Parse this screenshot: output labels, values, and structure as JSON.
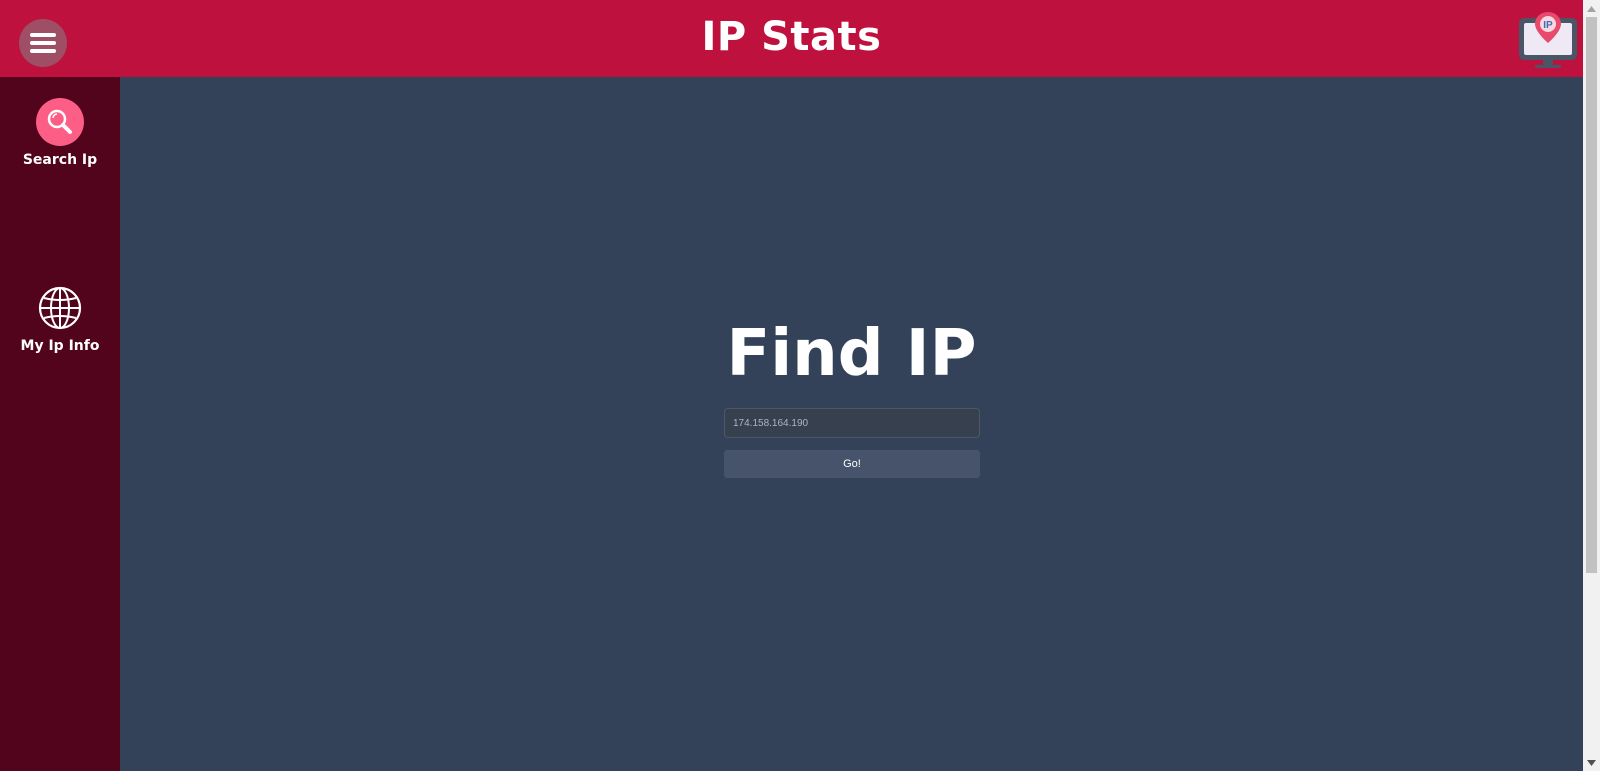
{
  "header": {
    "title": "IP Stats",
    "menu_icon": "hamburger-menu-icon",
    "logo_icon": "ip-monitor-logo-icon",
    "logo_text": "IP"
  },
  "sidebar": {
    "items": [
      {
        "label": "Search Ip",
        "icon": "search-icon"
      },
      {
        "label": "My Ip Info",
        "icon": "globe-icon"
      }
    ]
  },
  "main": {
    "heading": "Find IP",
    "search": {
      "placeholder": "174.158.164.190",
      "value": ""
    },
    "go_label": "Go!"
  },
  "colors": {
    "header_bg": "#bf113d",
    "sidebar_bg": "#51041c",
    "main_bg": "#334159",
    "accent_pink": "#fd5e85",
    "button_bg": "#46536a"
  }
}
